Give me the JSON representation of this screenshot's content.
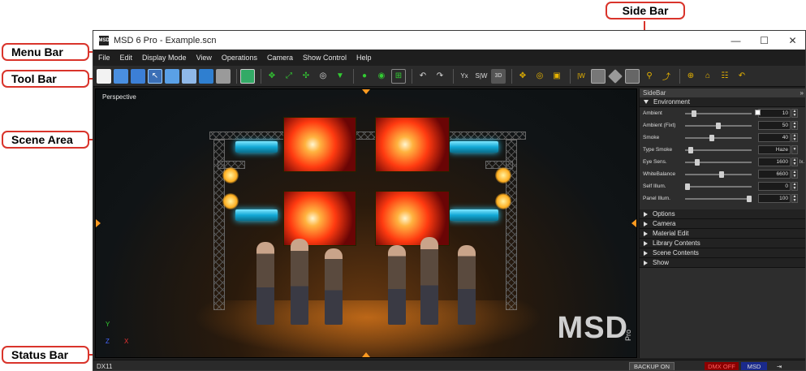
{
  "callouts": {
    "menu_bar": "Menu Bar",
    "tool_bar": "Tool Bar",
    "scene_area": "Scene Area",
    "status_bar": "Status Bar",
    "side_bar": "Side Bar"
  },
  "window": {
    "title": "MSD 6 Pro - Example.scn",
    "app_icon_text": "MSD",
    "minimize": "—",
    "maximize": "☐",
    "close": "✕"
  },
  "menu": [
    "File",
    "Edit",
    "Display Mode",
    "View",
    "Operations",
    "Camera",
    "Show Control",
    "Help"
  ],
  "toolbar": {
    "icons": [
      "new-file-icon",
      "open-folder-icon",
      "save-folder-icon",
      "select-arrow-icon",
      "screen-icon",
      "copy-icon",
      "link-icon",
      "gray-box-icon",
      "paint-bucket-icon",
      "move-icon",
      "scale-icon",
      "rotate-icon",
      "orbit-icon",
      "drop-icon",
      "zoom-in-icon",
      "zoom-fit-icon",
      "zoom-frame-icon",
      "undo-icon",
      "redo-icon",
      "axis-yx-icon",
      "axis-sw-icon",
      "view-3d-icon",
      "align-icon",
      "target-icon",
      "distribute-icon",
      "axis-w-icon",
      "sidebar-toggle-icon",
      "eraser-icon",
      "save-icon",
      "hook-icon",
      "chart-icon",
      "add-circle-icon",
      "lock-icon",
      "dmx-icon",
      "undo2-icon"
    ],
    "label_3d": "3D"
  },
  "scene": {
    "viewport_label": "Perspective",
    "logo_text": "MSD",
    "logo_sub": "Pro",
    "axis_y": "Y",
    "axis_z": "Z",
    "axis_x": "X"
  },
  "sidebar": {
    "title": "SideBar",
    "pin": "»",
    "environment_label": "Environment",
    "properties": [
      {
        "label": "Ambient",
        "value": "10",
        "knob": 0.1,
        "unit": ""
      },
      {
        "label": "Ambient (Fixt)",
        "value": "50",
        "knob": 0.5,
        "unit": ""
      },
      {
        "label": "Smoke",
        "value": "40",
        "knob": 0.4,
        "unit": ""
      },
      {
        "label": "Type Smoke",
        "value": "Haze",
        "knob": 0.05,
        "unit": ""
      },
      {
        "label": "Eye Sens.",
        "value": "1600",
        "knob": 0.16,
        "unit": "lx."
      },
      {
        "label": "WhiteBalance",
        "value": "6600",
        "knob": 0.55,
        "unit": ""
      },
      {
        "label": "Self Illum.",
        "value": "0",
        "knob": 0.0,
        "unit": ""
      },
      {
        "label": "Panel Illum.",
        "value": "100",
        "knob": 1.0,
        "unit": ""
      }
    ],
    "sections": [
      "Options",
      "Camera",
      "Material Edit",
      "Library Contents",
      "Scene Contents",
      "Show"
    ]
  },
  "status": {
    "renderer": "DX11",
    "backup": "BACKUP ON",
    "dmx": "DMX OFF",
    "msd": "MSD",
    "plug_icon": "⇥"
  },
  "colors": {
    "callout_border": "#d9342b",
    "dmx_off_bg": "#8b0000",
    "msd_bg": "#1a2a8c"
  }
}
